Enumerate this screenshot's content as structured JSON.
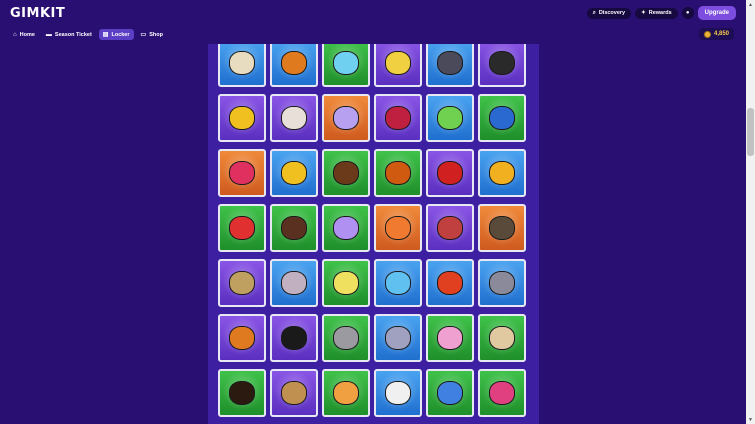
{
  "header": {
    "logo": "GIMKIT",
    "nav": [
      {
        "label": "Home",
        "icon": "home-icon",
        "active": false
      },
      {
        "label": "Season Ticket",
        "icon": "ticket-icon",
        "active": false
      },
      {
        "label": "Locker",
        "icon": "locker-icon",
        "active": true
      },
      {
        "label": "Shop",
        "icon": "shop-icon",
        "active": false
      }
    ],
    "discovery_label": "Discovery",
    "rewards_label": "Rewards",
    "upgrade_label": "Upgrade",
    "coins": "4,850"
  },
  "colors": {
    "background": "#2a0f73",
    "panel": "#3d1fa1",
    "rarity_green": "#3fc24a",
    "rarity_blue": "#4aa3f0",
    "rarity_purple": "#8a55e6",
    "rarity_orange": "#f08a3a",
    "coin": "#f7c948"
  },
  "locker": {
    "columns": 6,
    "tiles": [
      {
        "rarity": "green",
        "icon": "sand-pile-icon",
        "color": "#c98b3a"
      },
      {
        "rarity": "green",
        "icon": "crate-icon",
        "color": "#8a6a4a"
      },
      {
        "rarity": "green",
        "icon": "sand-pile-icon",
        "color": "#d9a864"
      },
      {
        "rarity": "blue",
        "icon": "box-icon",
        "color": "#b98a5a"
      },
      {
        "rarity": "blue",
        "icon": "pyramid-icon",
        "color": "#d98a3a"
      },
      {
        "rarity": "green",
        "icon": "cart-icon",
        "color": "#6a2f2f"
      },
      {
        "rarity": "blue",
        "icon": "scroll-icon",
        "color": "#e8dcc0"
      },
      {
        "rarity": "blue",
        "icon": "pumpkin-icon",
        "color": "#e07a1f"
      },
      {
        "rarity": "green",
        "icon": "scarecrow-icon",
        "color": "#6fd0f0"
      },
      {
        "rarity": "purple",
        "icon": "corn-icon",
        "color": "#f0d040"
      },
      {
        "rarity": "blue",
        "icon": "watering-can-icon",
        "color": "#4a4a5a"
      },
      {
        "rarity": "purple",
        "icon": "sombrero-guy-icon",
        "color": "#2a2a2a"
      },
      {
        "rarity": "purple",
        "icon": "trophy-icon",
        "color": "#f0c020"
      },
      {
        "rarity": "purple",
        "icon": "moth-icon",
        "color": "#e8e0d8"
      },
      {
        "rarity": "orange",
        "icon": "butterfly-icon",
        "color": "#b8a0f0"
      },
      {
        "rarity": "purple",
        "icon": "berries-icon",
        "color": "#c02040"
      },
      {
        "rarity": "blue",
        "icon": "grasshopper-icon",
        "color": "#70d050"
      },
      {
        "rarity": "green",
        "icon": "beetle-icon",
        "color": "#2a6ad0"
      },
      {
        "rarity": "orange",
        "icon": "raspberry-icon",
        "color": "#e03060"
      },
      {
        "rarity": "blue",
        "icon": "bee-icon",
        "color": "#f0c020"
      },
      {
        "rarity": "green",
        "icon": "cockroach-icon",
        "color": "#6a3a1a"
      },
      {
        "rarity": "green",
        "icon": "ladybug-icon",
        "color": "#d05a10"
      },
      {
        "rarity": "purple",
        "icon": "ant-icon",
        "color": "#d02020"
      },
      {
        "rarity": "blue",
        "icon": "honeycomb-icon",
        "color": "#f0b020"
      },
      {
        "rarity": "green",
        "icon": "robot-icon",
        "color": "#e03030"
      },
      {
        "rarity": "green",
        "icon": "reindeer-icon",
        "color": "#5a3020"
      },
      {
        "rarity": "green",
        "icon": "slime-icon",
        "color": "#b090f0"
      },
      {
        "rarity": "orange",
        "icon": "fox-icon",
        "color": "#f07a30"
      },
      {
        "rarity": "purple",
        "icon": "yarn-balls-icon",
        "color": "#c04040"
      },
      {
        "rarity": "orange",
        "icon": "siamese-cat-icon",
        "color": "#5a4a3a"
      },
      {
        "rarity": "purple",
        "icon": "scratching-post-icon",
        "color": "#c0a060"
      },
      {
        "rarity": "blue",
        "icon": "toy-mouse-icon",
        "color": "#c0b0c0"
      },
      {
        "rarity": "green",
        "icon": "yellow-cat-icon",
        "color": "#f0e060"
      },
      {
        "rarity": "blue",
        "icon": "blue-cat-icon",
        "color": "#60c0f0"
      },
      {
        "rarity": "blue",
        "icon": "red-cat-icon",
        "color": "#e04020"
      },
      {
        "rarity": "blue",
        "icon": "gray-cat-icon",
        "color": "#8a8a9a"
      },
      {
        "rarity": "purple",
        "icon": "tabby-cat-icon",
        "color": "#e07a20"
      },
      {
        "rarity": "purple",
        "icon": "black-cat-icon",
        "color": "#1a1a1a"
      },
      {
        "rarity": "green",
        "icon": "gray-tabby-cat-icon",
        "color": "#9a9aa0"
      },
      {
        "rarity": "blue",
        "icon": "toy-mice-icon",
        "color": "#a0a0c0"
      },
      {
        "rarity": "green",
        "icon": "pink-cat-icon",
        "color": "#f0a0d0"
      },
      {
        "rarity": "green",
        "icon": "pug-icon",
        "color": "#e0c8a0"
      },
      {
        "rarity": "green",
        "icon": "rottweiler-icon",
        "color": "#2a1a10"
      },
      {
        "rarity": "purple",
        "icon": "bone-icon",
        "color": "#c09050"
      },
      {
        "rarity": "green",
        "icon": "corgi-icon",
        "color": "#f0a040"
      },
      {
        "rarity": "blue",
        "icon": "dalmatian-icon",
        "color": "#f0f0f0"
      },
      {
        "rarity": "green",
        "icon": "food-bowl-icon",
        "color": "#4080e0"
      },
      {
        "rarity": "green",
        "icon": "pet-bowls-icon",
        "color": "#e04080"
      }
    ]
  }
}
